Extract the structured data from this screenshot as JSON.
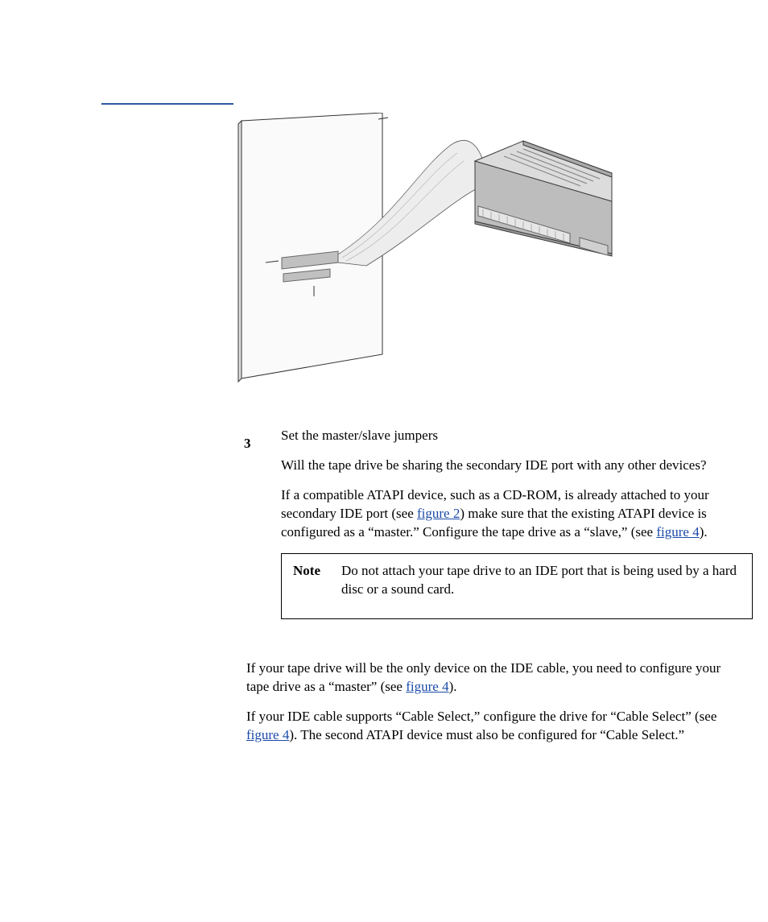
{
  "step": {
    "number_label": "3",
    "title": "Set the master/slave jumpers",
    "question": "Will the tape drive be sharing the secondary IDE port with any other devices?",
    "para1_a": "If a compatible ATAPI device, such as a CD-ROM, is already attached to your secondary IDE port (see ",
    "para1_link1": "figure 2",
    "para1_b": ") make sure that the existing ATAPI device is configured as a “master.” Configure the tape drive as a “slave,” (see ",
    "para1_link2": "figure 4",
    "para1_c": ").",
    "note_label": "Note",
    "note_text": "Do not attach your tape drive to an IDE port that is being used by a hard disc or a sound card.",
    "para2_a": "If your tape drive will be the only device on the IDE cable, you need to configure your tape drive as a “master” (see ",
    "para2_link1": "figure 4",
    "para2_b": ").",
    "para3_a": "If your IDE cable supports “Cable Select,” configure the drive for “Cable Select” (see ",
    "para3_link1": "figure 4",
    "para3_b": "). The second ATAPI device must also be configured for “Cable Select.”"
  },
  "figure": {
    "name": "secondary-ide-port-illustration"
  }
}
